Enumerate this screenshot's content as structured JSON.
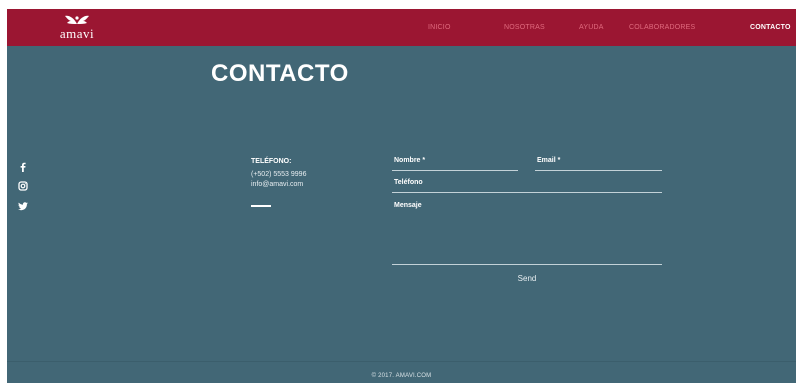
{
  "brand": {
    "logo_text": "amavi"
  },
  "nav": {
    "items": [
      {
        "label": "INICIO"
      },
      {
        "label": "NOSOTRAS"
      },
      {
        "label": "AYUDA"
      },
      {
        "label": "COLABORADORES"
      },
      {
        "label": "CONTACTO",
        "active": true
      }
    ]
  },
  "page": {
    "title": "CONTACTO"
  },
  "social": {
    "icons": [
      "facebook-icon",
      "instagram-icon",
      "twitter-icon"
    ]
  },
  "contact_info": {
    "label": "TELÉFONO:",
    "phone": "(+502) 5553 9996",
    "email": "info@amavi.com"
  },
  "form": {
    "name_label": "Nombre *",
    "email_label": "Email *",
    "phone_label": "Teléfono",
    "message_label": "Mensaje",
    "send_label": "Send"
  },
  "footer": {
    "text": "© 2017. AMAVI.COM"
  },
  "colors": {
    "topbar": "#9b1632",
    "background": "#426776",
    "nav_inactive": "#e06a7e",
    "nav_active": "#ffffff"
  }
}
